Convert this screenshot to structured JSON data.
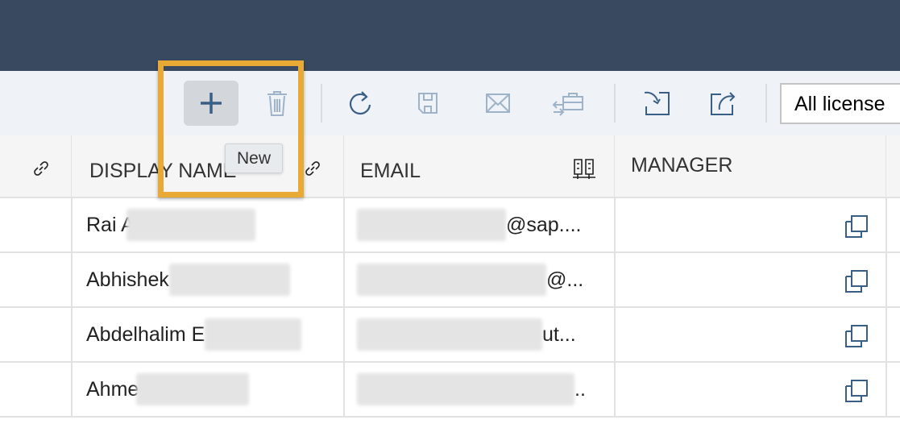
{
  "toolbar": {
    "tooltip": "New",
    "license_filter": "All license",
    "buttons": [
      "new",
      "delete",
      "refresh",
      "save",
      "email",
      "transfer",
      "import",
      "export"
    ]
  },
  "table": {
    "columns": [
      "",
      "DISPLAY NAME",
      "EMAIL",
      "MANAGER"
    ],
    "rows": [
      {
        "display_name": "Rai A",
        "email_suffix": "@sap...."
      },
      {
        "display_name": "Abhishek",
        "email_suffix": "@..."
      },
      {
        "display_name": "Abdelhalim E",
        "email_suffix": "ut..."
      },
      {
        "display_name": "Ahmet",
        "email_suffix": ".."
      }
    ]
  },
  "colors": {
    "header_bar": "#394a60",
    "highlight": "#e8a935",
    "icon": "#3a5f86"
  }
}
